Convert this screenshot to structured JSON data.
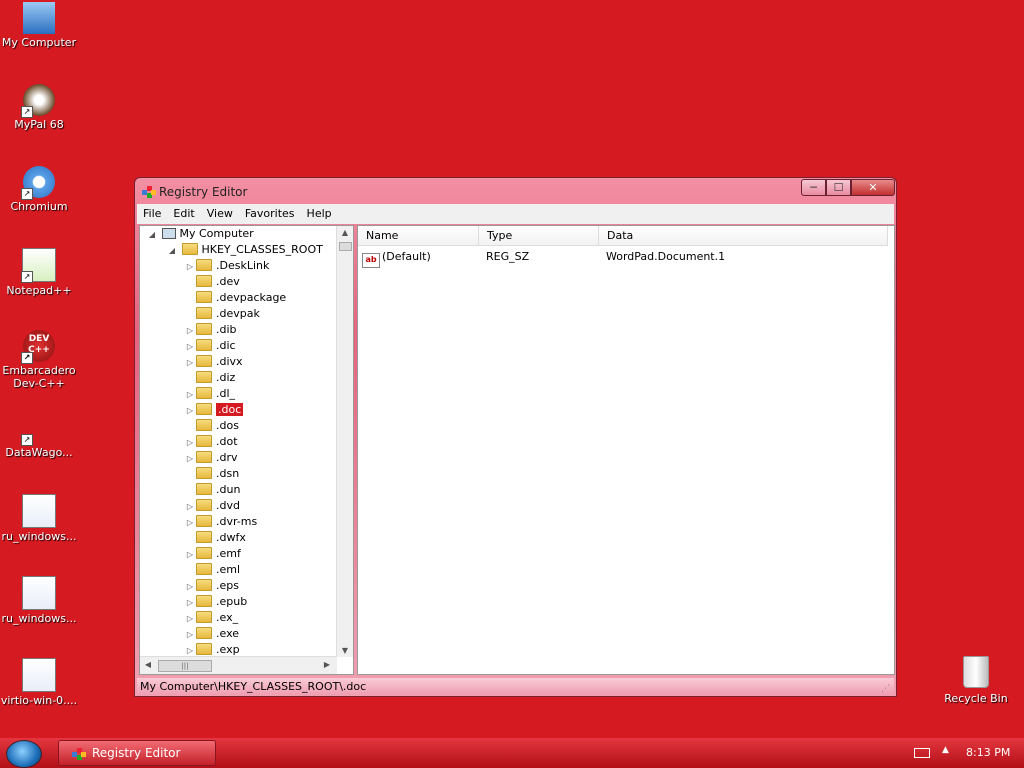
{
  "desktop": {
    "icons": [
      {
        "label": "My Computer",
        "icon": "computer-icon"
      },
      {
        "label": "MyPal 68",
        "icon": "mypal-icon"
      },
      {
        "label": "Chromium",
        "icon": "chromium-icon"
      },
      {
        "label": "Notepad++",
        "icon": "notepadpp-icon"
      },
      {
        "label": "Embarcadero\nDev-C++",
        "icon": "devcpp-icon",
        "icon_text": "DEV\nC++"
      },
      {
        "label": "DataWago...",
        "icon": "datawago-icon"
      },
      {
        "label": "ru_windows...",
        "icon": "document-icon"
      },
      {
        "label": "ru_windows...",
        "icon": "document-icon"
      },
      {
        "label": "virtio-win-0....",
        "icon": "document-icon"
      }
    ],
    "recycle_bin": {
      "label": "Recycle Bin",
      "icon": "recycle-bin-icon"
    }
  },
  "window": {
    "title": "Registry Editor",
    "controls": {
      "minimize": "─",
      "maximize": "☐",
      "close": "✕"
    },
    "menu": [
      "File",
      "Edit",
      "View",
      "Favorites",
      "Help"
    ],
    "tree": {
      "root": "My Computer",
      "hive": "HKEY_CLASSES_ROOT",
      "keys": [
        {
          "name": ".DeskLink",
          "expandable": true
        },
        {
          "name": ".dev",
          "expandable": false
        },
        {
          "name": ".devpackage",
          "expandable": false
        },
        {
          "name": ".devpak",
          "expandable": false
        },
        {
          "name": ".dib",
          "expandable": true
        },
        {
          "name": ".dic",
          "expandable": true
        },
        {
          "name": ".divx",
          "expandable": true
        },
        {
          "name": ".diz",
          "expandable": false
        },
        {
          "name": ".dl_",
          "expandable": true
        },
        {
          "name": ".doc",
          "expandable": true,
          "selected": true
        },
        {
          "name": ".dos",
          "expandable": false
        },
        {
          "name": ".dot",
          "expandable": true
        },
        {
          "name": ".drv",
          "expandable": true
        },
        {
          "name": ".dsn",
          "expandable": false
        },
        {
          "name": ".dun",
          "expandable": false
        },
        {
          "name": ".dvd",
          "expandable": true
        },
        {
          "name": ".dvr-ms",
          "expandable": true
        },
        {
          "name": ".dwfx",
          "expandable": false
        },
        {
          "name": ".emf",
          "expandable": true
        },
        {
          "name": ".eml",
          "expandable": false
        },
        {
          "name": ".eps",
          "expandable": true
        },
        {
          "name": ".epub",
          "expandable": true
        },
        {
          "name": ".ex_",
          "expandable": true
        },
        {
          "name": ".exe",
          "expandable": true
        },
        {
          "name": ".exp",
          "expandable": true
        }
      ]
    },
    "list": {
      "columns": [
        "Name",
        "Type",
        "Data"
      ],
      "rows": [
        {
          "name": "(Default)",
          "type": "REG_SZ",
          "data": "WordPad.Document.1",
          "icon": "string-value-icon",
          "icon_text": "ab"
        }
      ]
    },
    "status": "My Computer\\HKEY_CLASSES_ROOT\\.doc"
  },
  "taskbar": {
    "task": "Registry Editor",
    "clock": "8:13 PM"
  },
  "colors": {
    "desktop": "#d61a22",
    "selection": "#d61a22"
  }
}
